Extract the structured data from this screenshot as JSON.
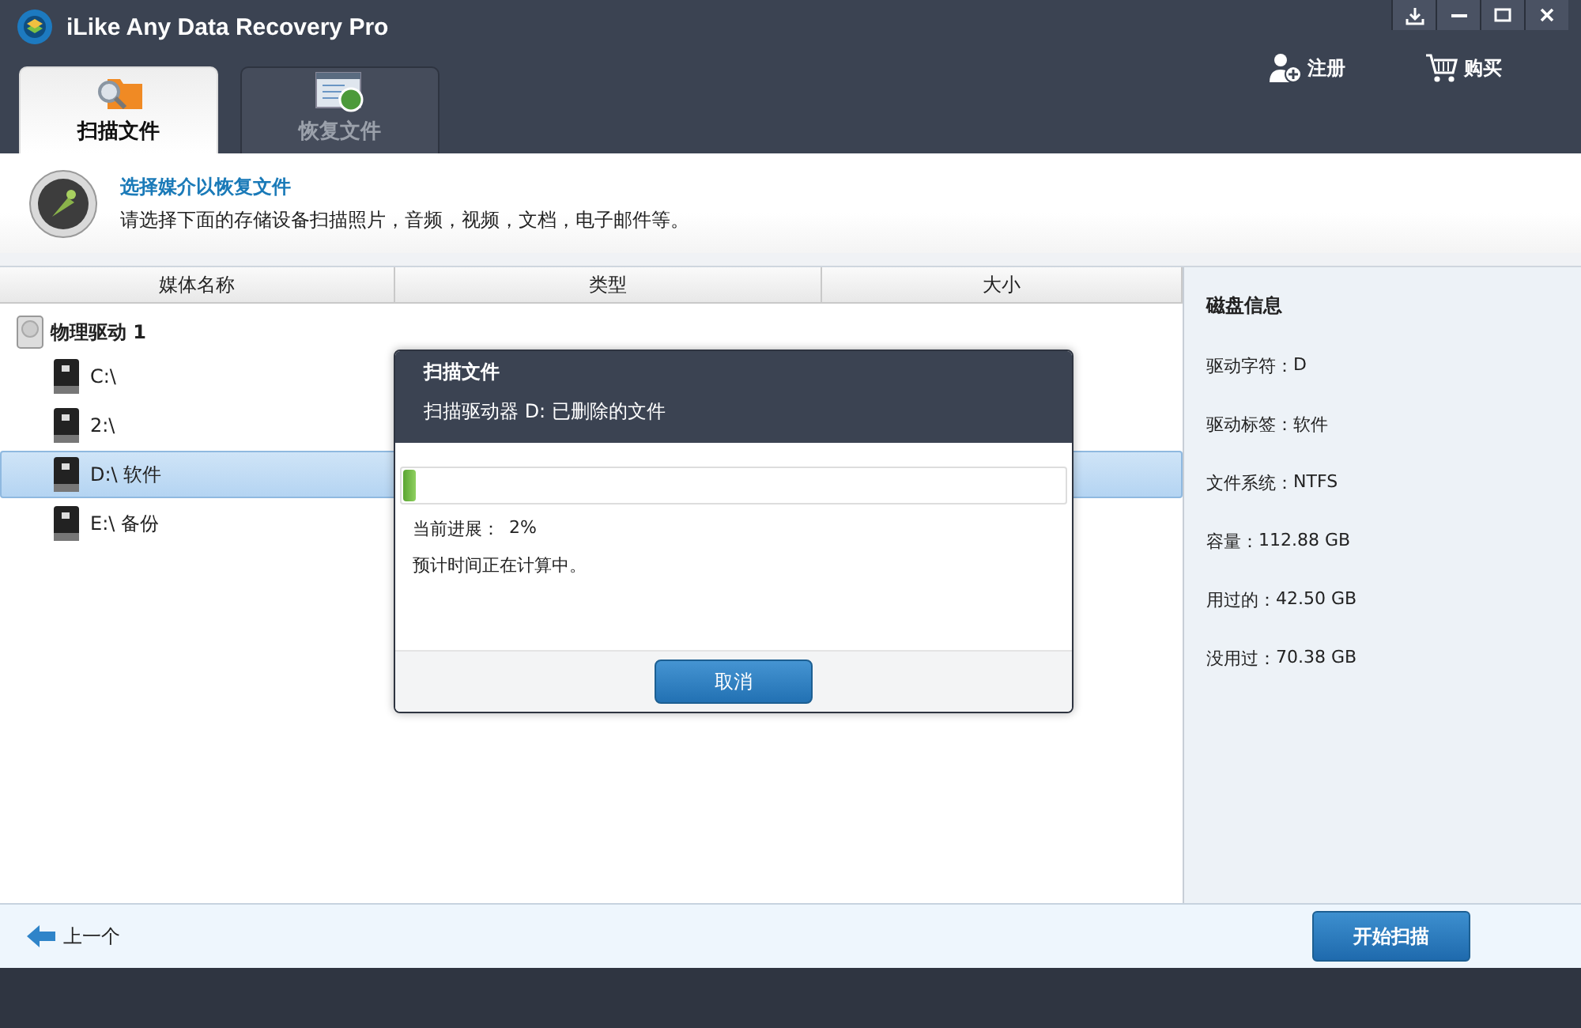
{
  "window": {
    "title": "iLike Any Data Recovery Pro"
  },
  "window_controls": [
    {
      "kind": "download"
    },
    {
      "kind": "minimize"
    },
    {
      "kind": "maximize"
    },
    {
      "kind": "close"
    }
  ],
  "toolbar": [
    {
      "kind": "register",
      "label": "注册"
    },
    {
      "kind": "buy",
      "label": "购买"
    }
  ],
  "tabs": [
    {
      "kind": "scan",
      "label": "扫描文件",
      "selected": true
    },
    {
      "kind": "recover",
      "label": "恢复文件",
      "selected": false
    }
  ],
  "header": {
    "title": "选择媒介以恢复文件",
    "description": "请选择下面的存储设备扫描照片，音频，视频，文档，电子邮件等。"
  },
  "table": {
    "columns": [
      "媒体名称",
      "类型",
      "大小"
    ],
    "tree": [
      {
        "label": "物理驱动 1",
        "children": [
          {
            "label": "C:\\",
            "selected": false
          },
          {
            "label": "2:\\",
            "selected": false
          },
          {
            "label": "D:\\ 软件",
            "selected": true
          },
          {
            "label": "E:\\ 备份",
            "selected": false
          }
        ]
      }
    ]
  },
  "disk_info": {
    "title": "磁盘信息",
    "rows": [
      {
        "label": "驱动字符：",
        "value": "D"
      },
      {
        "label": "驱动标签：",
        "value": "软件"
      },
      {
        "label": "文件系统：",
        "value": "NTFS"
      },
      {
        "label": "容量：",
        "value": "112.88 GB"
      },
      {
        "label": "用过的：",
        "value": "42.50 GB"
      },
      {
        "label": "没用过：",
        "value": "70.38 GB"
      }
    ]
  },
  "dialog": {
    "title": "扫描文件",
    "subtitle": "扫描驱动器 D: 已删除的文件",
    "progress": {
      "level": 0.02
    },
    "progress_label": "当前进展：",
    "progress_value": "2%",
    "eta": "预计时间正在计算中。",
    "button": "取消"
  },
  "nav": {
    "back": "上一个",
    "start": "开始扫描"
  }
}
